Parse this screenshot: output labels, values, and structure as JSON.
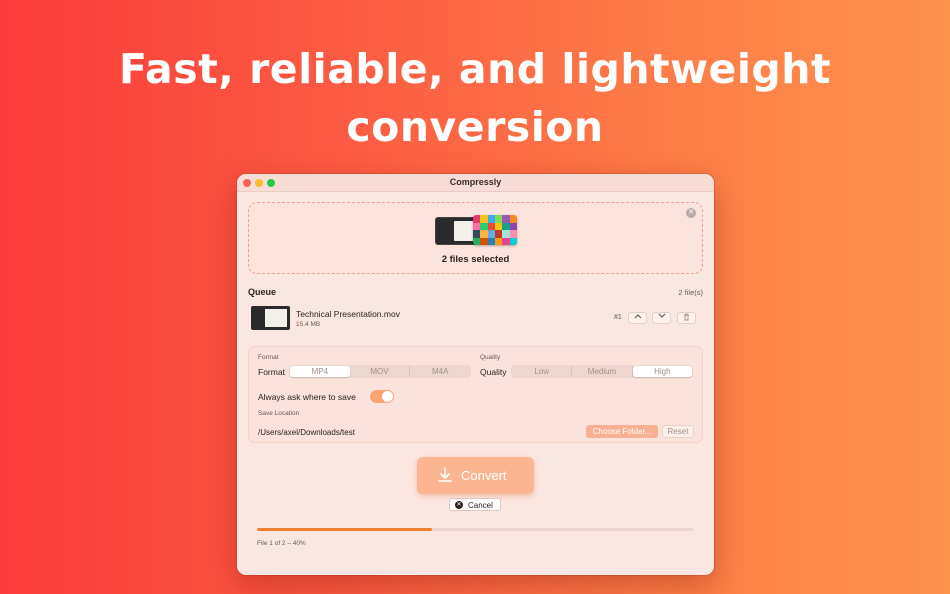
{
  "headline": {
    "line1": "Fast, reliable, and lightweight",
    "line2": "conversion"
  },
  "window": {
    "title": "Compressly"
  },
  "dropzone": {
    "label": "2 files selected",
    "close_icon": "close-circle-icon"
  },
  "queue": {
    "title": "Queue",
    "count": "2 file(s)",
    "items": [
      {
        "name": "Technical Presentation.mov",
        "size": "15.4 MB",
        "index": "#1",
        "up_icon": "chevron-up-icon",
        "down_icon": "chevron-down-icon",
        "delete_icon": "trash-icon"
      }
    ]
  },
  "settings": {
    "format_section": "Format",
    "format_label": "Format",
    "format_options": [
      "MP4",
      "MOV",
      "M4A"
    ],
    "format_selected": "MP4",
    "quality_section": "Quality",
    "quality_label": "Quality",
    "quality_options": [
      "Low",
      "Medium",
      "High"
    ],
    "quality_selected": "High",
    "ask_save_label": "Always ask where to save",
    "ask_save_on": true,
    "save_location_section": "Save Location",
    "save_path": "/Users/axel/Downloads/test",
    "choose_folder_label": "Choose Folder...",
    "reset_label": "Reset"
  },
  "actions": {
    "convert_label": "Convert",
    "convert_icon": "download-arrow-icon",
    "cancel_label": "Cancel",
    "cancel_icon": "cancel-circle-icon"
  },
  "progress": {
    "percent": 40,
    "text": "File 1 of 2 – 40%"
  },
  "colors": {
    "accent": "#f17f2f",
    "convert_button": "#fbb691",
    "window_bg": "#fbe7e1"
  }
}
